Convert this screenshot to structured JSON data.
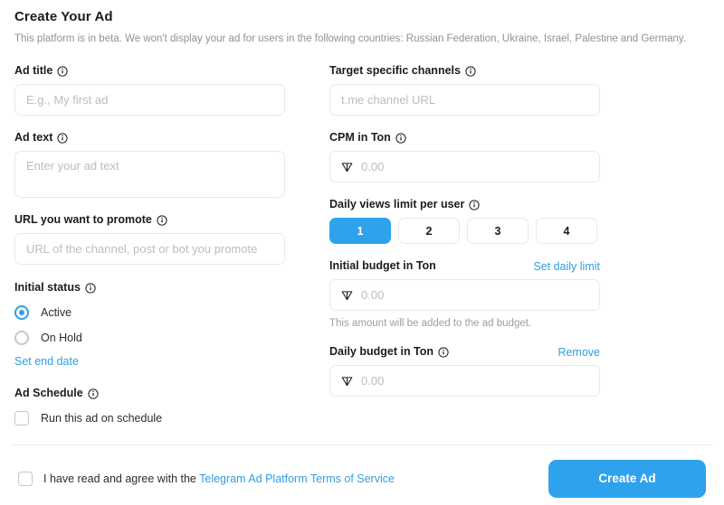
{
  "header": {
    "title": "Create Your Ad",
    "subtitle": "This platform is in beta. We won't display your ad for users in the following countries: Russian Federation, Ukraine, Israel, Palestine and Germany."
  },
  "colors": {
    "accent": "#2fa2ee",
    "link": "#2f9fe3",
    "placeholder": "#b9bdc2",
    "border": "#e7e9ec",
    "text": "#1c1c1e",
    "muted": "#8e9297"
  },
  "left_column": {
    "ad_title": {
      "label": "Ad title",
      "info_icon": "info-circle-icon",
      "placeholder": "E.g., My first ad",
      "value": ""
    },
    "ad_text": {
      "label": "Ad text",
      "info_icon": "info-circle-icon",
      "placeholder": "Enter your ad text",
      "value": ""
    },
    "promote_url": {
      "label": "URL you want to promote",
      "info_icon": "info-circle-icon",
      "placeholder": "URL of the channel, post or bot you promote",
      "value": ""
    },
    "initial_status": {
      "label": "Initial status",
      "info_icon": "info-circle-icon",
      "options": [
        {
          "label": "Active",
          "selected": true
        },
        {
          "label": "On Hold",
          "selected": false
        }
      ],
      "set_end_date_link": "Set end date"
    },
    "ad_schedule": {
      "label": "Ad Schedule",
      "info_icon": "info-circle-icon",
      "checkbox_label": "Run this ad on schedule",
      "checked": false
    }
  },
  "right_column": {
    "target_channels": {
      "label": "Target specific channels",
      "info_icon": "info-circle-icon",
      "placeholder": "t.me channel URL",
      "value": ""
    },
    "cpm": {
      "label": "CPM in Ton",
      "info_icon": "info-circle-icon",
      "currency_icon": "ton-icon",
      "placeholder": "0.00",
      "value": ""
    },
    "daily_views_limit": {
      "label": "Daily views limit per user",
      "info_icon": "info-circle-icon",
      "options": [
        "1",
        "2",
        "3",
        "4"
      ],
      "selected": "1"
    },
    "initial_budget": {
      "label": "Initial budget in Ton",
      "action_link": "Set daily limit",
      "currency_icon": "ton-icon",
      "placeholder": "0.00",
      "value": "",
      "hint": "This amount will be added to the ad budget."
    },
    "daily_budget": {
      "label": "Daily budget in Ton",
      "info_icon": "info-circle-icon",
      "action_link": "Remove",
      "currency_icon": "ton-icon",
      "placeholder": "0.00",
      "value": ""
    }
  },
  "footer": {
    "terms_prefix": "I have read and agree with the",
    "terms_link": "Telegram Ad Platform Terms of Service",
    "terms_checked": false,
    "submit_label": "Create Ad"
  }
}
